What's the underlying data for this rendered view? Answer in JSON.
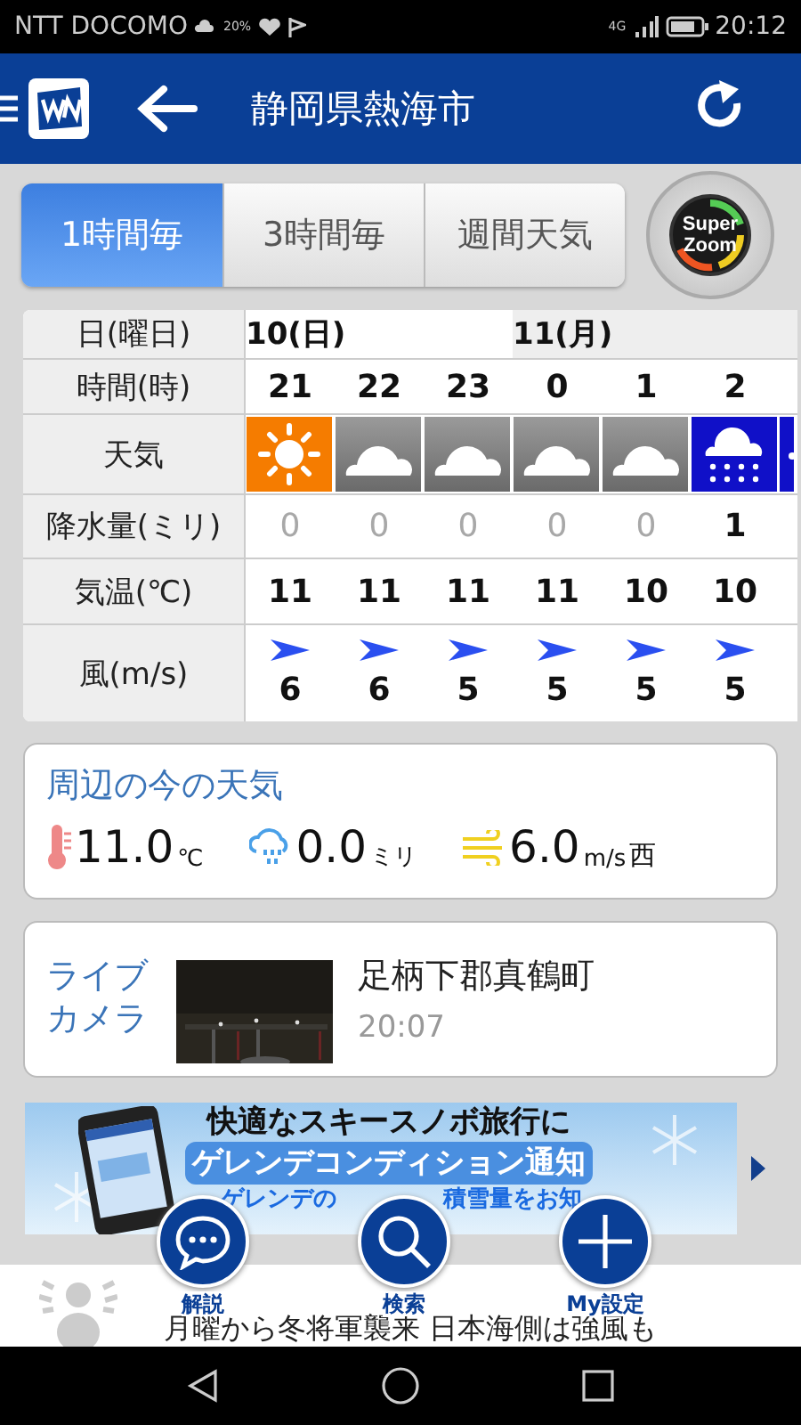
{
  "status_bar": {
    "carrier": "NTT DOCOMO",
    "rain_chance": "20%",
    "network": "4G",
    "time": "20:12"
  },
  "app_bar": {
    "title": "静岡県熱海市"
  },
  "tabs": [
    {
      "label": "1時間毎",
      "selected": true
    },
    {
      "label": "3時間毎",
      "selected": false
    },
    {
      "label": "週間天気",
      "selected": false
    }
  ],
  "super_zoom": {
    "line_1": "Super",
    "line_2": "Zoom"
  },
  "forecast": {
    "row_labels": {
      "date": "日(曜日)",
      "hour": "時間(時)",
      "weather": "天気",
      "precip": "降水量(ミリ)",
      "temp": "気温(℃)",
      "wind": "風(m/s)"
    },
    "dates": [
      {
        "label": "10(日)"
      },
      {
        "label": "11(月)"
      }
    ],
    "hours": [
      {
        "hour": "21",
        "weather": {
          "kind": "sunny"
        },
        "precip": "0",
        "precip_dim": true,
        "temp": "11",
        "wind": "6"
      },
      {
        "hour": "22",
        "weather": {
          "kind": "cloudy"
        },
        "precip": "0",
        "precip_dim": true,
        "temp": "11",
        "wind": "6"
      },
      {
        "hour": "23",
        "weather": {
          "kind": "cloudy"
        },
        "precip": "0",
        "precip_dim": true,
        "temp": "11",
        "wind": "5"
      },
      {
        "hour": "0",
        "weather": {
          "kind": "cloudy"
        },
        "precip": "0",
        "precip_dim": true,
        "temp": "11",
        "wind": "5"
      },
      {
        "hour": "1",
        "weather": {
          "kind": "cloudy"
        },
        "precip": "0",
        "precip_dim": true,
        "temp": "10",
        "wind": "5"
      },
      {
        "hour": "2",
        "weather": {
          "kind": "rain"
        },
        "precip": "1",
        "precip_dim": false,
        "temp": "10",
        "wind": "5"
      }
    ],
    "next_weather": {
      "kind": "rain"
    }
  },
  "current": {
    "title": "周辺の今の天気",
    "temp": "11.0",
    "temp_unit": "℃",
    "rain": "0.0",
    "rain_unit": "ミリ",
    "wind": "6.0",
    "wind_unit": "m/s",
    "wind_dir": "西"
  },
  "live_camera": {
    "label": "ライブカメラ",
    "location": "足柄下郡真鶴町",
    "time": "20:07"
  },
  "banner": {
    "line_1": "快適なスキースノボ旅行に",
    "line_2": "ゲレンデコンディション通知",
    "line_3a": "ゲレンデの",
    "line_3b": "積雪量をお知"
  },
  "fabs": [
    {
      "kind": "chat",
      "label": "解説"
    },
    {
      "kind": "search",
      "label": "検索"
    },
    {
      "kind": "add",
      "label": "My設定"
    }
  ],
  "news": {
    "text": "月曜から冬将軍襲来 日本海側は強風も"
  }
}
